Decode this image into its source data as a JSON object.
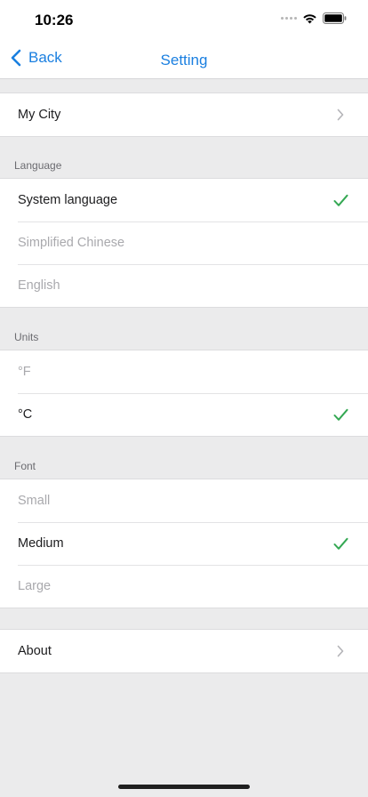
{
  "status_bar": {
    "time": "10:26"
  },
  "nav": {
    "back_label": "Back",
    "title": "Setting"
  },
  "city": {
    "label": "My City"
  },
  "language": {
    "header": "Language",
    "options": [
      {
        "label": "System language",
        "selected": true
      },
      {
        "label": "Simplified Chinese",
        "selected": false
      },
      {
        "label": "English",
        "selected": false
      }
    ]
  },
  "units": {
    "header": "Units",
    "options": [
      {
        "label": "°F",
        "selected": false
      },
      {
        "label": "°C",
        "selected": true
      }
    ]
  },
  "font": {
    "header": "Font",
    "options": [
      {
        "label": "Small",
        "selected": false
      },
      {
        "label": "Medium",
        "selected": true
      },
      {
        "label": "Large",
        "selected": false
      }
    ]
  },
  "about": {
    "label": "About"
  },
  "colors": {
    "accent": "#1a7fe0",
    "checkmark": "#34a853",
    "background": "#ebebec",
    "dimmed_text": "#a9a9ad"
  },
  "icons": {
    "back": "chevron-left-icon",
    "disclosure": "chevron-right-icon",
    "selected": "checkmark-icon",
    "wifi": "wifi-icon",
    "battery": "battery-icon",
    "signal": "signal-icon"
  }
}
